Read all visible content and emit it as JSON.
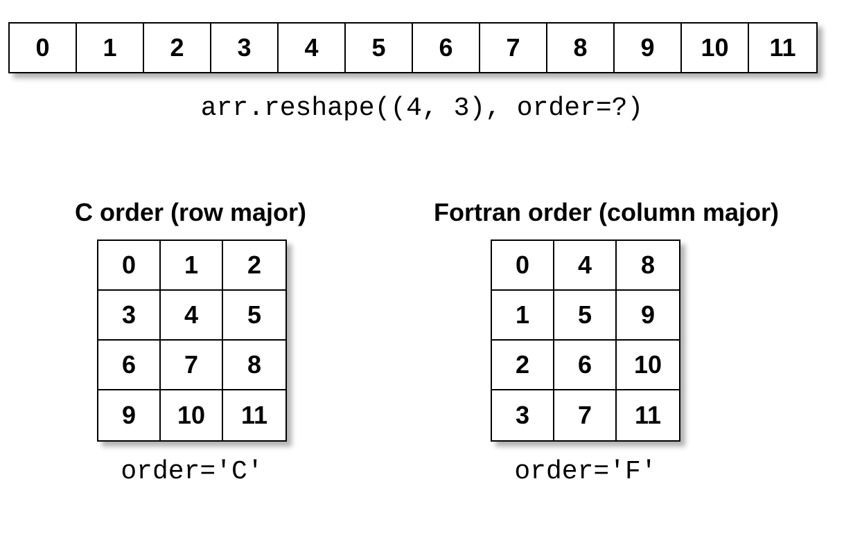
{
  "linear": {
    "values": [
      "0",
      "1",
      "2",
      "3",
      "4",
      "5",
      "6",
      "7",
      "8",
      "9",
      "10",
      "11"
    ]
  },
  "caption_main": "arr.reshape((4, 3), order=?)",
  "c_order": {
    "title": "C order (row major)",
    "caption": "order='C'",
    "rows": [
      [
        "0",
        "1",
        "2"
      ],
      [
        "3",
        "4",
        "5"
      ],
      [
        "6",
        "7",
        "8"
      ],
      [
        "9",
        "10",
        "11"
      ]
    ]
  },
  "f_order": {
    "title": "Fortran order (column major)",
    "caption": "order='F'",
    "rows": [
      [
        "0",
        "4",
        "8"
      ],
      [
        "1",
        "5",
        "9"
      ],
      [
        "2",
        "6",
        "10"
      ],
      [
        "3",
        "7",
        "11"
      ]
    ]
  },
  "chart_data": {
    "type": "table",
    "title": "numpy reshape order comparison",
    "input_1d": [
      0,
      1,
      2,
      3,
      4,
      5,
      6,
      7,
      8,
      9,
      10,
      11
    ],
    "reshape_shape": [
      4,
      3
    ],
    "function_call": "arr.reshape((4, 3), order=?)",
    "orders": [
      {
        "name": "C order (row major)",
        "param": "order='C'",
        "matrix": [
          [
            0,
            1,
            2
          ],
          [
            3,
            4,
            5
          ],
          [
            6,
            7,
            8
          ],
          [
            9,
            10,
            11
          ]
        ]
      },
      {
        "name": "Fortran order (column major)",
        "param": "order='F'",
        "matrix": [
          [
            0,
            4,
            8
          ],
          [
            1,
            5,
            9
          ],
          [
            2,
            6,
            10
          ],
          [
            3,
            7,
            11
          ]
        ]
      }
    ]
  }
}
